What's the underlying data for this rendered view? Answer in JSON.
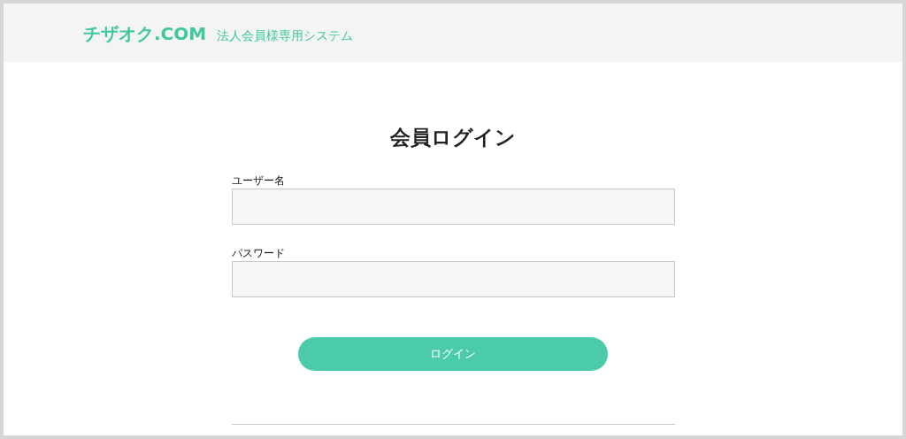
{
  "header": {
    "logo": "チザオク.COM",
    "subtitle": "法人会員様専用システム"
  },
  "login": {
    "title": "会員ログイン",
    "fields": [
      {
        "label": "ユーザー名"
      },
      {
        "label": "パスワード"
      }
    ],
    "button": "ログイン"
  }
}
